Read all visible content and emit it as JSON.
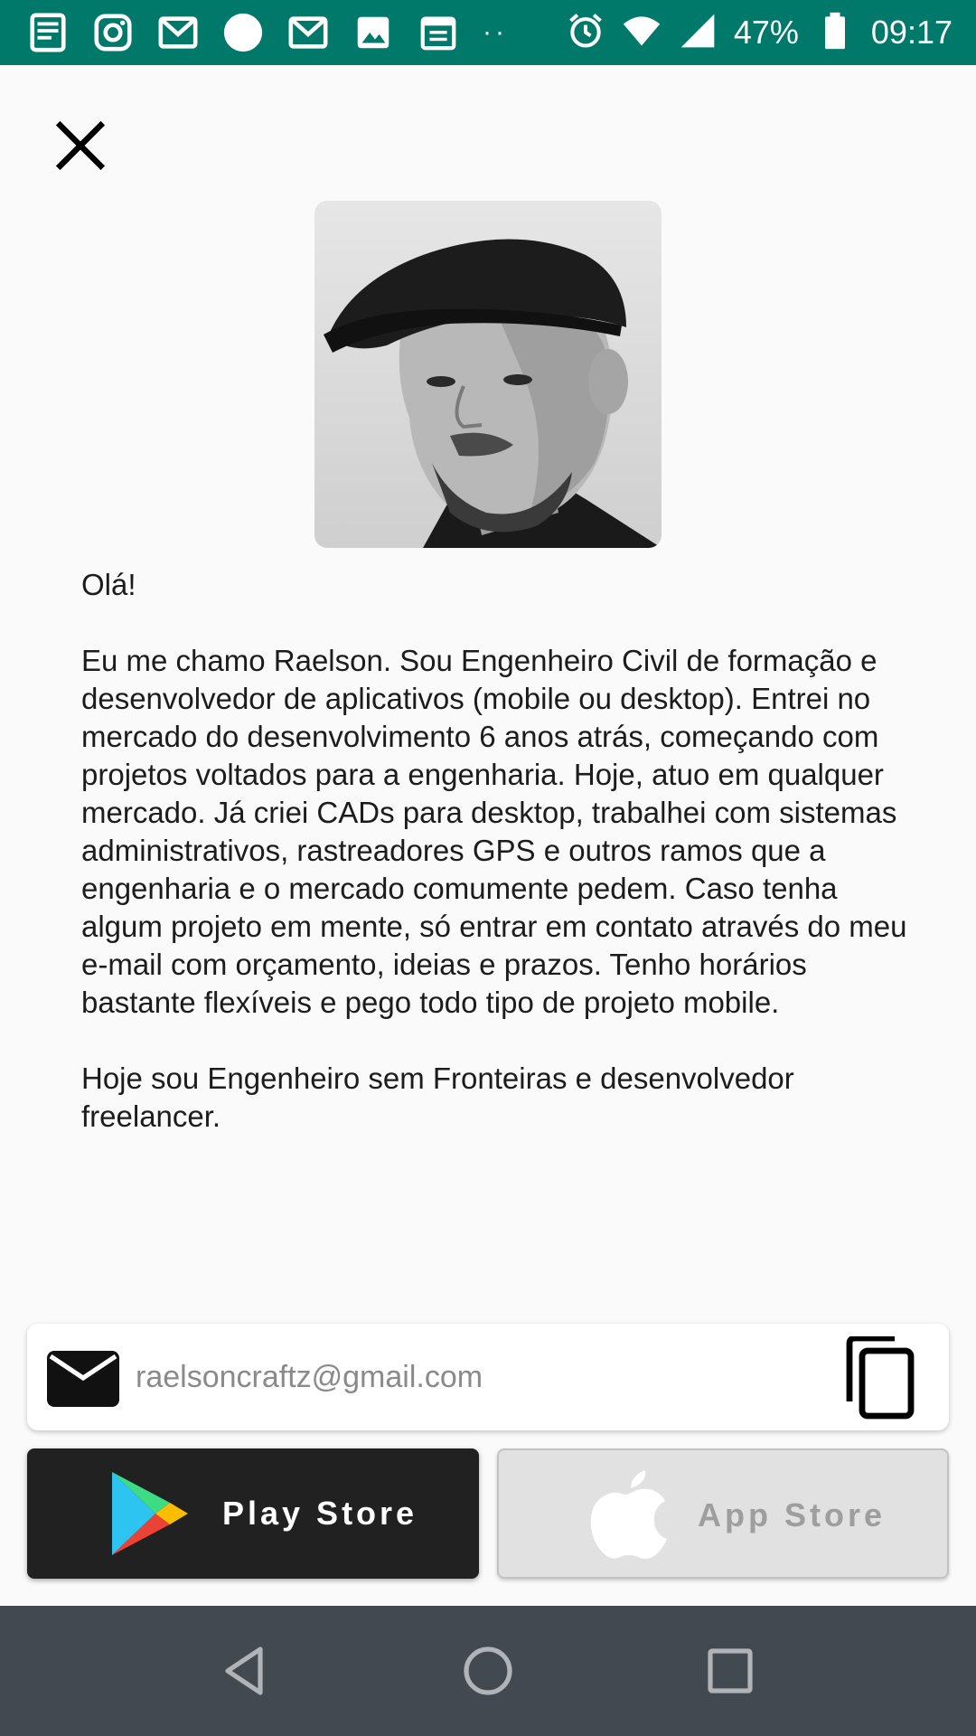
{
  "status_bar": {
    "battery": "47%",
    "time": "09:17",
    "dots": "··",
    "icons": [
      "news-icon",
      "instagram-icon",
      "gmail-icon",
      "circle-icon",
      "gmail-icon",
      "image-icon",
      "calendar-icon",
      "alarm-icon",
      "wifi-icon",
      "signal-icon",
      "battery-icon"
    ]
  },
  "colors": {
    "status_bar": "#00796b",
    "background": "#fafafa",
    "play_store_button": "#212121",
    "app_store_button": "#e1e1e1",
    "nav_bar": "#424950"
  },
  "header": {
    "close_icon": "close-icon"
  },
  "profile": {
    "avatar": "profile-photo"
  },
  "bio": {
    "greeting": "Olá!",
    "paragraph_1": "Eu me chamo Raelson. Sou Engenheiro Civil de formação e desenvolvedor de aplicativos (mobile ou desktop). Entrei no mercado do desenvolvimento 6 anos atrás, começando com projetos voltados para a engenharia. Hoje, atuo em qualquer mercado. Já criei CADs para desktop, trabalhei com sistemas administrativos, rastreadores GPS e outros ramos que a engenharia e o mercado comumente pedem. Caso tenha algum projeto em mente, só entrar em contato através do meu e-mail com orçamento, ideias e prazos. Tenho horários bastante flexíveis e pego todo tipo de projeto mobile.",
    "paragraph_2": "Hoje sou Engenheiro sem Fronteiras e desenvolvedor freelancer."
  },
  "contact": {
    "email": "raelsoncraftz@gmail.com",
    "mail_icon": "mail-icon",
    "copy_icon": "copy-icon"
  },
  "stores": {
    "play_store_label": "Play Store",
    "app_store_label": "App Store"
  },
  "nav": {
    "back": "back-icon",
    "home": "home-icon",
    "recent": "recent-apps-icon"
  }
}
